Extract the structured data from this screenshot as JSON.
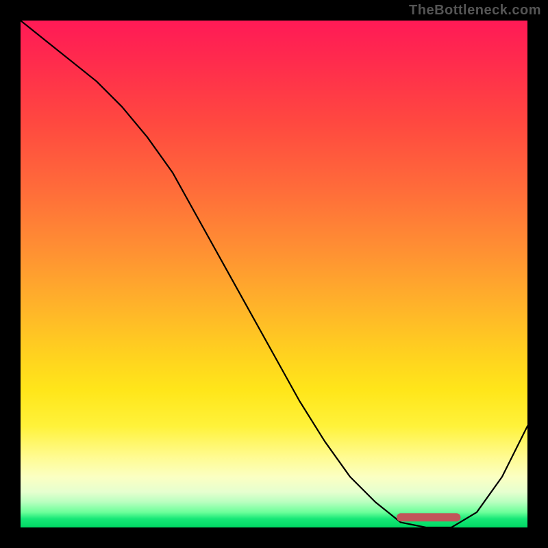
{
  "watermark": "TheBottleneck.com",
  "colors": {
    "curve": "#000000",
    "marker": "#c1565a",
    "gradient_top": "#ff1a56",
    "gradient_bottom": "#00d864"
  },
  "chart_data": {
    "type": "line",
    "title": "",
    "xlabel": "",
    "ylabel": "",
    "xlim": [
      0,
      100
    ],
    "ylim": [
      0,
      100
    ],
    "x": [
      0,
      5,
      10,
      15,
      20,
      25,
      30,
      35,
      40,
      45,
      50,
      55,
      60,
      65,
      70,
      75,
      80,
      85,
      90,
      95,
      100
    ],
    "series": [
      {
        "name": "bottleneck-curve",
        "values": [
          100,
          96,
          92,
          88,
          83,
          77,
          70,
          61,
          52,
          43,
          34,
          25,
          17,
          10,
          5,
          1,
          0,
          0,
          3,
          10,
          20
        ]
      }
    ],
    "marker": {
      "x_start": 75,
      "x_end": 86,
      "y": 2
    }
  }
}
